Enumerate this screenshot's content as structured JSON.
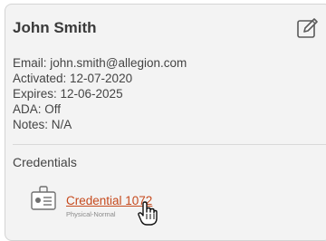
{
  "user": {
    "name": "John Smith",
    "email": "Email: john.smith@allegion.com",
    "activated": "Activated: 12-07-2020",
    "expires": "Expires: 12-06-2025",
    "ada": "ADA: Off",
    "notes": "Notes: N/A"
  },
  "credentials": {
    "title": "Credentials",
    "items": [
      {
        "label": "Credential 1072",
        "type": "Physical-Normal",
        "icon": "badge-icon"
      }
    ]
  },
  "icons": {
    "edit": "edit-icon",
    "cursor": "hand-pointer-cursor"
  },
  "colors": {
    "link": "#c64a1d",
    "card_bg": "#f3f3f3"
  }
}
